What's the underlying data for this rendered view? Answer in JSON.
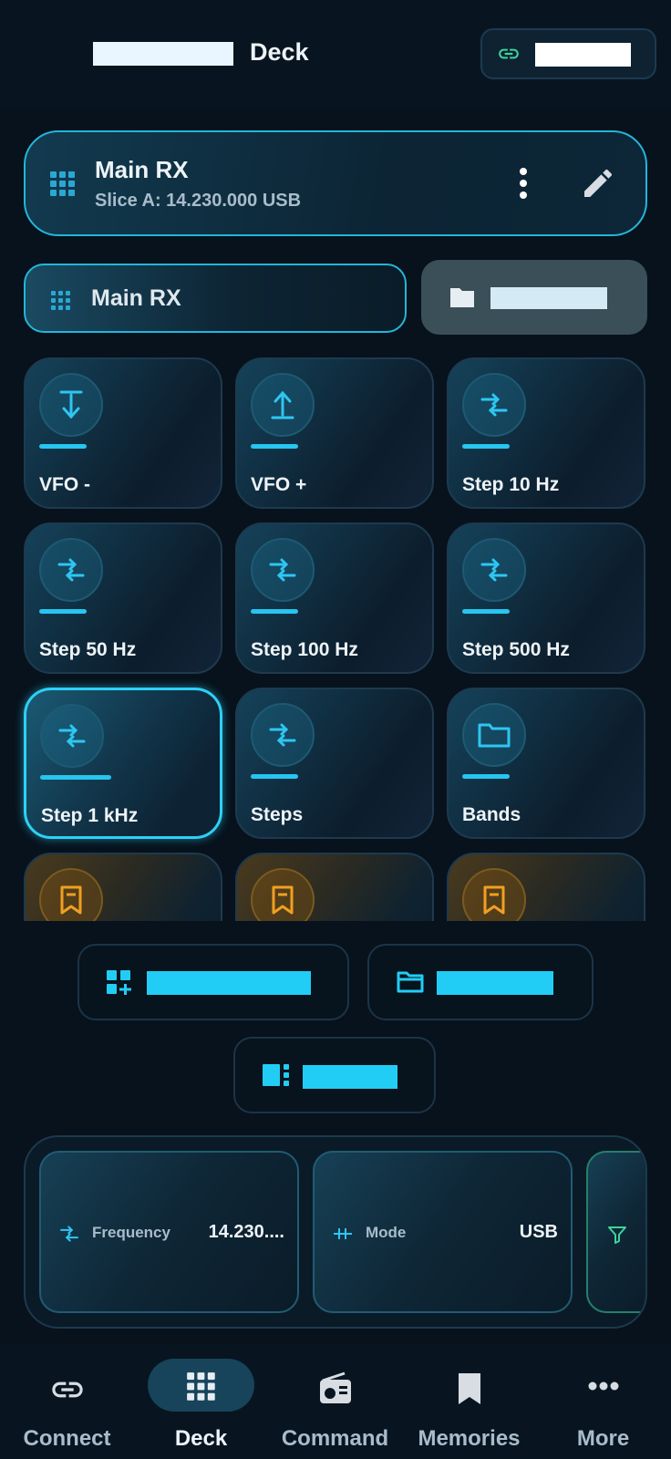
{
  "header": {
    "title": "Deck",
    "connection_icon": "link-icon",
    "accent_color": "#22cdf5"
  },
  "slice": {
    "title": "Main RX",
    "subtitle": "Slice A: 14.230.000 USB",
    "menu_icon": "more-vert-icon",
    "edit_icon": "pencil-icon"
  },
  "chips": {
    "active_label": "Main RX",
    "folder_icon": "folder-icon"
  },
  "tiles": [
    {
      "label": "VFO -",
      "icon": "arrow-down-bar-icon"
    },
    {
      "label": "VFO +",
      "icon": "arrow-up-bar-icon"
    },
    {
      "label": "Step 10 Hz",
      "icon": "swap-arrows-icon"
    },
    {
      "label": "Step 50 Hz",
      "icon": "swap-arrows-icon"
    },
    {
      "label": "Step 100 Hz",
      "icon": "swap-arrows-icon"
    },
    {
      "label": "Step 500 Hz",
      "icon": "swap-arrows-icon"
    },
    {
      "label": "Step 1 kHz",
      "icon": "swap-arrows-icon",
      "selected": true
    },
    {
      "label": "Steps",
      "icon": "swap-arrows-icon"
    },
    {
      "label": "Bands",
      "icon": "folder-icon"
    },
    {
      "label": "",
      "icon": "bookmark-icon"
    },
    {
      "label": "",
      "icon": "bookmark-icon"
    },
    {
      "label": "",
      "icon": "bookmark-icon"
    }
  ],
  "actions": {
    "add_tile_icon": "add-tile-icon",
    "folder_icon": "folder-outline-icon",
    "layout_icon": "layout-icon"
  },
  "status": {
    "frequency_label": "Frequency",
    "frequency_value": "14.230....",
    "mode_label": "Mode",
    "mode_value": "USB",
    "filter_icon": "filter-icon"
  },
  "nav": {
    "items": [
      {
        "label": "Connect",
        "icon": "link-icon"
      },
      {
        "label": "Deck",
        "icon": "grid-icon",
        "active": true
      },
      {
        "label": "Command",
        "icon": "radio-icon"
      },
      {
        "label": "Memories",
        "icon": "bookmark-icon"
      },
      {
        "label": "More",
        "icon": "more-horiz-icon"
      }
    ]
  }
}
